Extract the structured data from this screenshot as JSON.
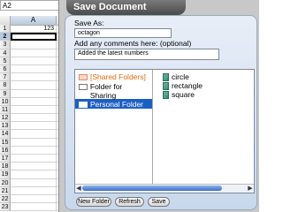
{
  "spreadsheet": {
    "name_box": "A2",
    "column_header": "A",
    "rows": [
      {
        "num": "1",
        "value": "123"
      },
      {
        "num": "2",
        "value": ""
      },
      {
        "num": "3",
        "value": ""
      },
      {
        "num": "4",
        "value": ""
      },
      {
        "num": "5",
        "value": ""
      },
      {
        "num": "6",
        "value": ""
      },
      {
        "num": "7",
        "value": ""
      },
      {
        "num": "8",
        "value": ""
      },
      {
        "num": "9",
        "value": ""
      },
      {
        "num": "10",
        "value": ""
      },
      {
        "num": "11",
        "value": ""
      },
      {
        "num": "12",
        "value": ""
      },
      {
        "num": "13",
        "value": ""
      },
      {
        "num": "14",
        "value": ""
      },
      {
        "num": "15",
        "value": ""
      },
      {
        "num": "16",
        "value": ""
      },
      {
        "num": "17",
        "value": ""
      },
      {
        "num": "18",
        "value": ""
      },
      {
        "num": "19",
        "value": ""
      },
      {
        "num": "20",
        "value": ""
      },
      {
        "num": "21",
        "value": ""
      },
      {
        "num": "22",
        "value": ""
      },
      {
        "num": "23",
        "value": ""
      }
    ]
  },
  "dialog": {
    "title": "Save Document",
    "save_as_label": "Save As:",
    "save_as_value": "octagon",
    "comments_label": "Add any comments here: (optional)",
    "comments_value": "Added the latest numbers",
    "folders": [
      {
        "label": "[Shared Folders]"
      },
      {
        "label": "Folder for Sharing"
      },
      {
        "label": "Personal Folder"
      }
    ],
    "files": [
      {
        "label": "circle"
      },
      {
        "label": "rectangle"
      },
      {
        "label": "square"
      }
    ],
    "buttons": {
      "new_folder": "New Folder",
      "refresh": "Refresh",
      "save": "Save"
    },
    "colors": {
      "selection": "#1c5fc4",
      "shared_folder_text": "#e06a10"
    }
  }
}
